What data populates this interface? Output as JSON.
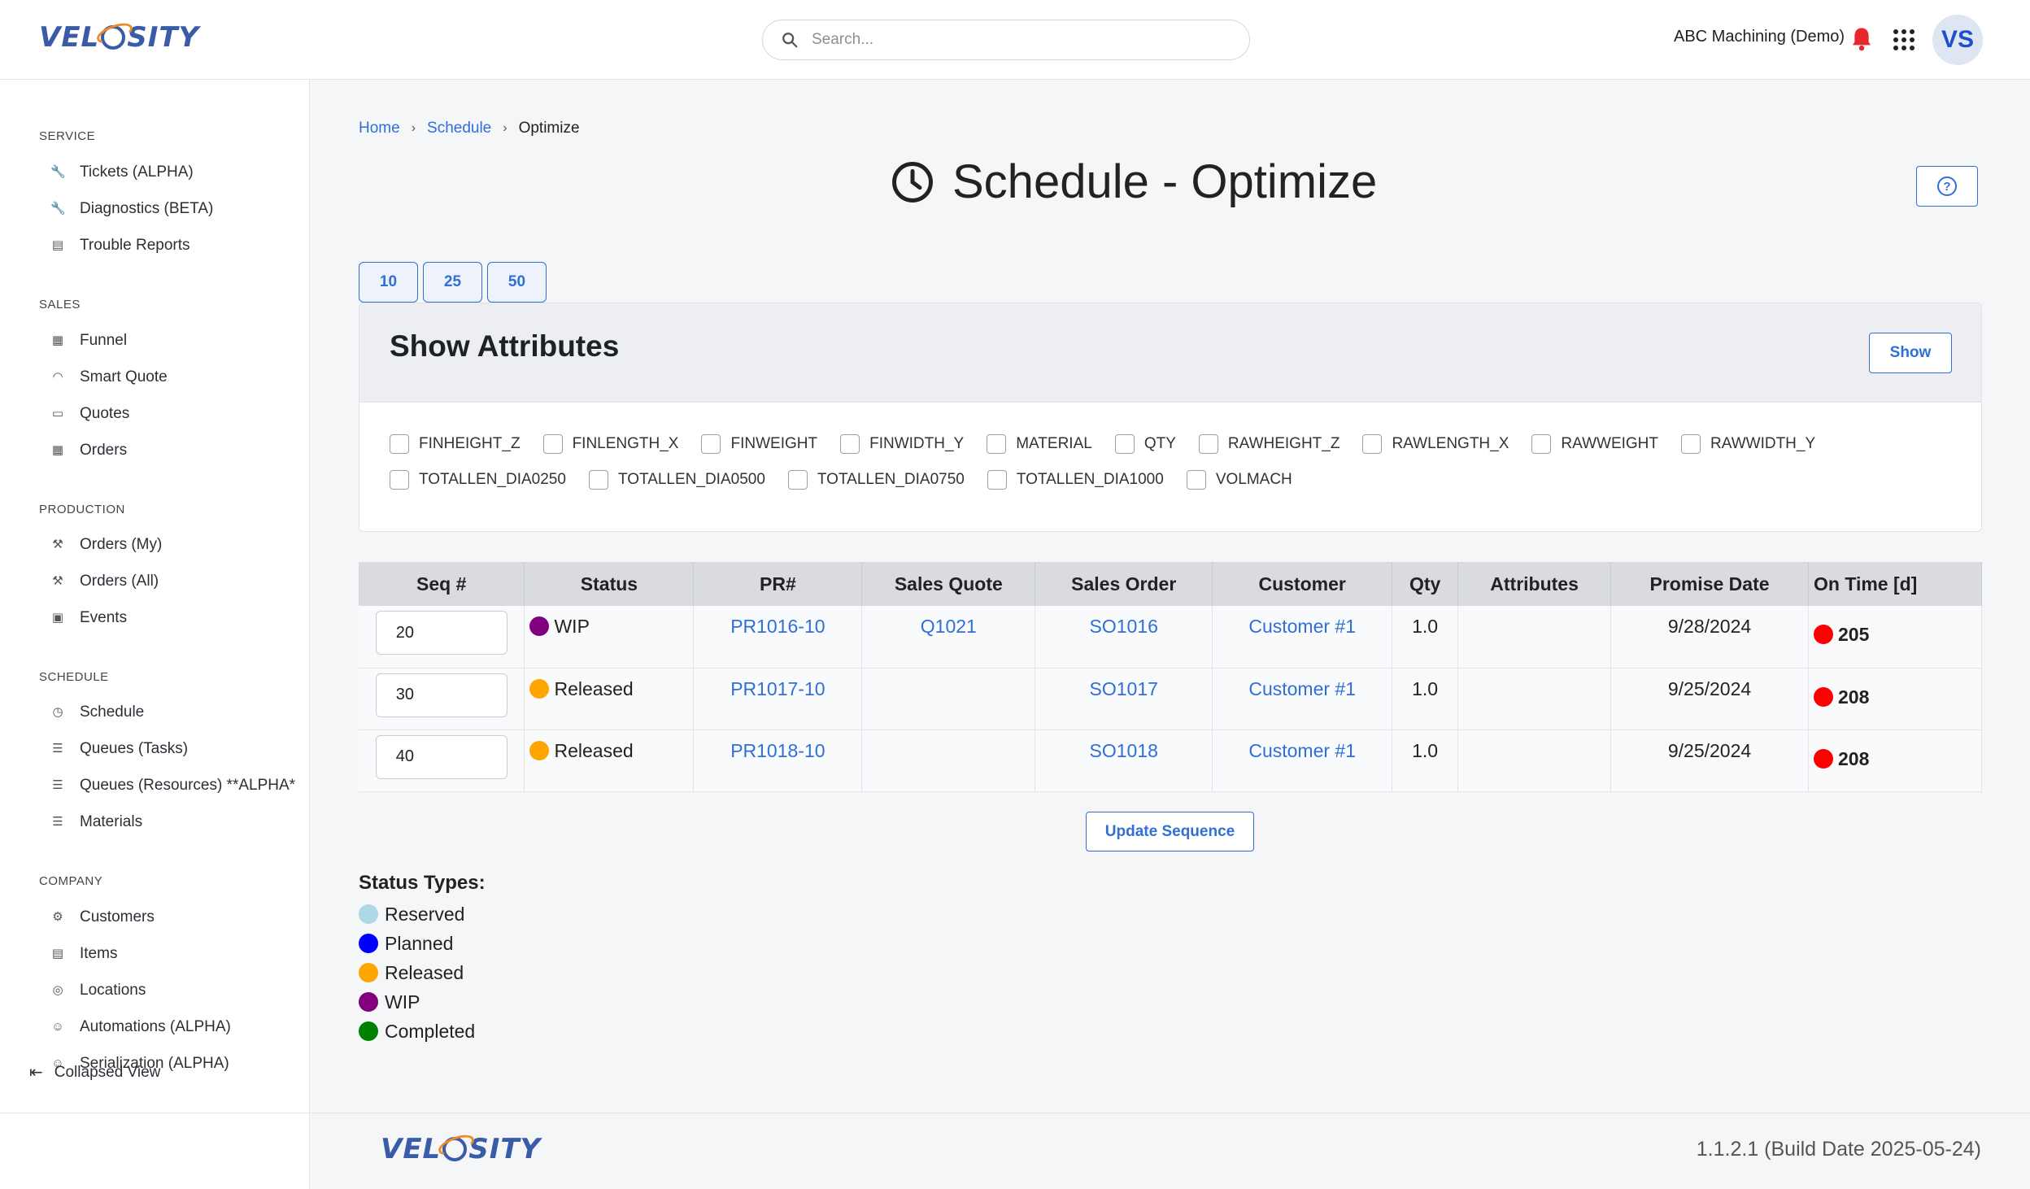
{
  "header": {
    "logo_pre": "VEL",
    "logo_post": "SITY",
    "search_placeholder": "Search...",
    "company": "ABC Machining (Demo)",
    "avatar": "VS"
  },
  "sidebar": {
    "sections": [
      {
        "title": "SERVICE",
        "items": [
          {
            "label": "Tickets (ALPHA)",
            "icon": "wrench-icon"
          },
          {
            "label": "Diagnostics (BETA)",
            "icon": "wrench-icon"
          },
          {
            "label": "Trouble Reports",
            "icon": "archive-icon"
          }
        ]
      },
      {
        "title": "SALES",
        "items": [
          {
            "label": "Funnel",
            "icon": "building-icon"
          },
          {
            "label": "Smart Quote",
            "icon": "hardhat-icon"
          },
          {
            "label": "Quotes",
            "icon": "ticket-icon"
          },
          {
            "label": "Orders",
            "icon": "table-icon"
          }
        ]
      },
      {
        "title": "PRODUCTION",
        "items": [
          {
            "label": "Orders (My)",
            "icon": "tools-icon"
          },
          {
            "label": "Orders (All)",
            "icon": "tools-icon"
          },
          {
            "label": "Events",
            "icon": "calendar-icon"
          }
        ]
      },
      {
        "title": "SCHEDULE",
        "items": [
          {
            "label": "Schedule",
            "icon": "clock-icon"
          },
          {
            "label": "Queues (Tasks)",
            "icon": "list-icon"
          },
          {
            "label": "Queues (Resources) **ALPHA*",
            "icon": "list-icon"
          },
          {
            "label": "Materials",
            "icon": "list-icon"
          }
        ]
      },
      {
        "title": "COMPANY",
        "items": [
          {
            "label": "Customers",
            "icon": "gear-icon"
          },
          {
            "label": "Items",
            "icon": "warehouse-icon"
          },
          {
            "label": "Locations",
            "icon": "pin-icon"
          },
          {
            "label": "Automations (ALPHA)",
            "icon": "robot-icon"
          },
          {
            "label": "Serialization (ALPHA)",
            "icon": "robot-icon"
          }
        ]
      }
    ],
    "collapse_label": "Collapsed View"
  },
  "breadcrumb": {
    "home": "Home",
    "schedule": "Schedule",
    "current": "Optimize"
  },
  "title": "Schedule - Optimize",
  "pager": [
    "10",
    "25",
    "50"
  ],
  "attributes": {
    "heading": "Show Attributes",
    "show_label": "Show",
    "items": [
      "FINHEIGHT_Z",
      "FINLENGTH_X",
      "FINWEIGHT",
      "FINWIDTH_Y",
      "MATERIAL",
      "QTY",
      "RAWHEIGHT_Z",
      "RAWLENGTH_X",
      "RAWWEIGHT",
      "RAWWIDTH_Y",
      "TOTALLEN_DIA0250",
      "TOTALLEN_DIA0500",
      "TOTALLEN_DIA0750",
      "TOTALLEN_DIA1000",
      "VOLMACH"
    ]
  },
  "table": {
    "columns": [
      "Seq #",
      "Status",
      "PR#",
      "Sales Quote",
      "Sales Order",
      "Customer",
      "Qty",
      "Attributes",
      "Promise Date",
      "On Time [d]"
    ],
    "rows": [
      {
        "seq": "20",
        "status": "WIP",
        "status_color": "#800080",
        "pr": "PR1016-10",
        "quote": "Q1021",
        "order": "SO1016",
        "customer": "Customer #1",
        "qty": "1.0",
        "attributes": "",
        "promise": "9/28/2024",
        "ontime": "205",
        "ontime_color": "#ff0000"
      },
      {
        "seq": "30",
        "status": "Released",
        "status_color": "#ffa500",
        "pr": "PR1017-10",
        "quote": "",
        "order": "SO1017",
        "customer": "Customer #1",
        "qty": "1.0",
        "attributes": "",
        "promise": "9/25/2024",
        "ontime": "208",
        "ontime_color": "#ff0000"
      },
      {
        "seq": "40",
        "status": "Released",
        "status_color": "#ffa500",
        "pr": "PR1018-10",
        "quote": "",
        "order": "SO1018",
        "customer": "Customer #1",
        "qty": "1.0",
        "attributes": "",
        "promise": "9/25/2024",
        "ontime": "208",
        "ontime_color": "#ff0000"
      }
    ]
  },
  "update_label": "Update Sequence",
  "legend": {
    "title": "Status Types:",
    "items": [
      {
        "label": "Reserved",
        "color": "#add8e6"
      },
      {
        "label": "Planned",
        "color": "#0000ff"
      },
      {
        "label": "Released",
        "color": "#ffa500"
      },
      {
        "label": "WIP",
        "color": "#800080"
      },
      {
        "label": "Completed",
        "color": "#008000"
      }
    ]
  },
  "footer": {
    "version": "1.1.2.1 (Build Date 2025-05-24)"
  }
}
